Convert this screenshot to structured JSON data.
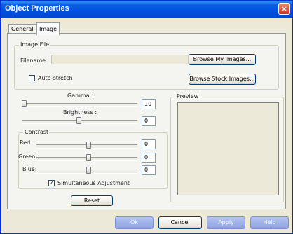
{
  "window": {
    "title": "Object Properties",
    "close_glyph": "×"
  },
  "tabs": [
    {
      "label": "General",
      "active": false
    },
    {
      "label": "Image",
      "active": true
    }
  ],
  "image_file": {
    "group_label": "Image File",
    "filename_label": "Filename",
    "filename_value": "",
    "browse_my_images": "Browse My Images...",
    "browse_stock_images": "Browse Stock Images...",
    "auto_stretch_label": "Auto-stretch",
    "auto_stretch_checked": false
  },
  "gamma": {
    "label": "Gamma :",
    "value": "10"
  },
  "brightness": {
    "label": "Brightness :",
    "value": "0"
  },
  "contrast": {
    "group_label": "Contrast",
    "red_label": "Red:",
    "red_value": "0",
    "green_label": "Green:",
    "green_value": "0",
    "blue_label": "Blue:",
    "blue_value": "0",
    "simultaneous_label": "Simultaneous Adjustment",
    "simultaneous_checked": true
  },
  "reset_label": "Reset",
  "preview": {
    "group_label": "Preview"
  },
  "footer": {
    "ok": "Ok",
    "cancel": "Cancel",
    "apply": "Apply",
    "help": "Help"
  }
}
